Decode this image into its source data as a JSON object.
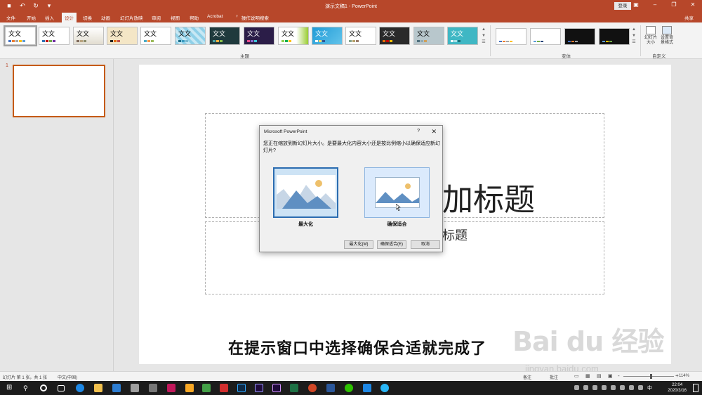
{
  "window": {
    "title": "演示文稿1  -  PowerPoint",
    "login_label": "登录",
    "quick_access": [
      "save-icon",
      "undo-icon",
      "redo-icon",
      "customize-icon"
    ]
  },
  "menu": {
    "tabs": [
      "文件",
      "开始",
      "插入",
      "设计",
      "切换",
      "动画",
      "幻灯片放映",
      "审阅",
      "视图",
      "帮助",
      "Acrobat"
    ],
    "active_tab": "设计",
    "tell_me": "操作说明搜索",
    "share": "共享"
  },
  "ribbon": {
    "themes_label": "主题",
    "variants_label": "变体",
    "customize_label": "自定义",
    "slide_size_label": "幻灯片\n大小",
    "format_bg_label": "设置背\n景格式",
    "theme_sample_text": "文文"
  },
  "thumbnails": {
    "number": "1"
  },
  "slide": {
    "title_fragment": "加标题",
    "subtitle_fragment": "标题"
  },
  "dialog": {
    "title": "Microsoft PowerPoint",
    "help": "?",
    "close": "✕",
    "message": "您正在缩放到新幻灯片大小。是要最大化内容大小还是按比例缩小以确保适应新幻灯片?",
    "option_maximize": "最大化",
    "option_ensure_fit": "确保适合",
    "btn_maximize": "最大化(M)",
    "btn_ensure_fit": "确保适合(E)",
    "btn_cancel": "取消"
  },
  "caption": "在提示窗口中选择确保合适就完成了",
  "watermark": {
    "logo": "Bai du 经验",
    "url": "jingyan.baidu.com"
  },
  "status": {
    "slide_info": "幻灯片 第 1 张，共 1 张",
    "language": "中文(中国)",
    "notes": "备注",
    "comments": "批注",
    "zoom": "114%"
  },
  "taskbar": {
    "time": "22:04",
    "date": "2020/3/16",
    "ime": "中"
  },
  "colors": {
    "accent": "#b7472a",
    "thumb_border": "#c55a11",
    "dialog_select": "#2b6cb0"
  }
}
